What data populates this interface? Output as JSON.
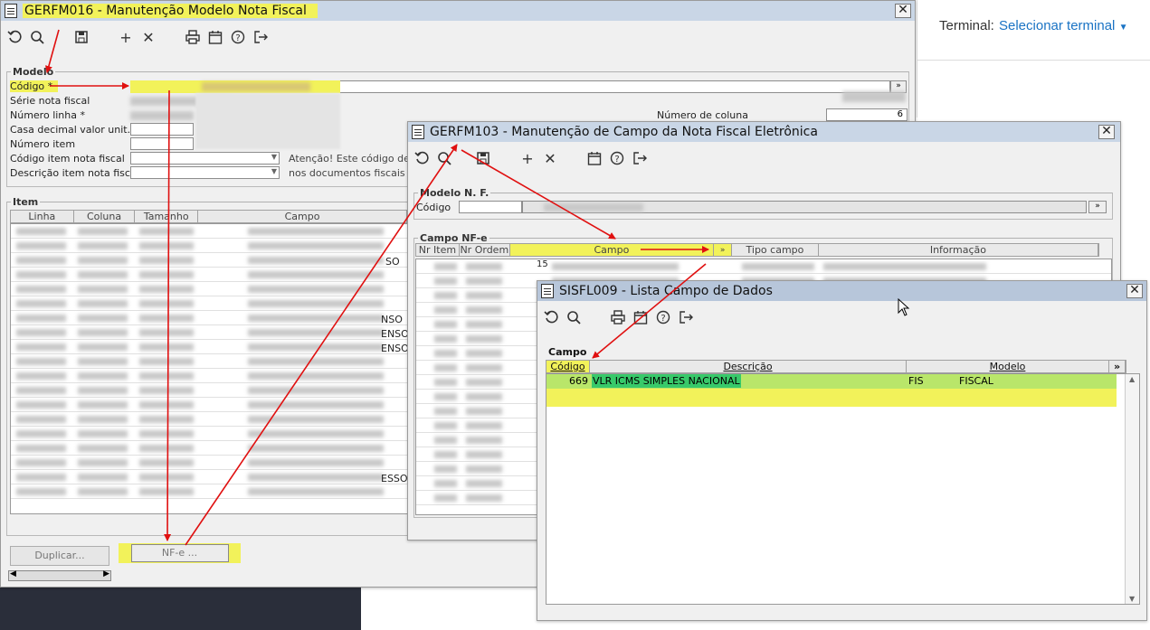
{
  "terminal": {
    "label": "Terminal:",
    "link": "Selecionar terminal"
  },
  "win1": {
    "title": "GERFM016 - Manutenção Modelo Nota Fiscal",
    "close": "✕",
    "group_modelo": "Modelo",
    "labels": {
      "codigo": "Código *",
      "serie": "Série nota fiscal",
      "numero_linha": "Número linha *",
      "casa_decimal": "Casa decimal valor unit.",
      "numero_item": "Número item",
      "codigo_item": "Código item nota fiscal",
      "descricao_item": "Descrição item nota fiscal",
      "numero_coluna": "Número de coluna"
    },
    "numero_coluna_value": "6",
    "atencao": "Atenção! Este código deve",
    "atencao2": "nos documentos fiscais e i",
    "group_item": "Item",
    "item_columns": [
      "Linha",
      "Coluna",
      "Tamanho",
      "Campo"
    ],
    "row_fragments": [
      "SO",
      "NSO",
      "ENSO",
      "ENSO",
      "ESSO"
    ],
    "buttons": {
      "duplicar": "Duplicar...",
      "nfe": "NF-e ..."
    }
  },
  "win2": {
    "title": "GERFM103 - Manutenção de Campo da Nota Fiscal Eletrônica",
    "close": "✕",
    "group_modelo": "Modelo N. F.",
    "codigo_label": "Código",
    "group_campo": "Campo NF-e",
    "columns": [
      "Nr Item",
      "Nr Ordem",
      "Campo",
      "Tipo campo",
      "Informação"
    ],
    "first_row_ordem": "15"
  },
  "win3": {
    "title": "SISFL009 - Lista Campo de Dados",
    "close": "✕",
    "group_campo": "Campo",
    "columns": [
      "Código",
      "Descrição",
      "Modelo"
    ],
    "more": "»",
    "rows": [
      {
        "codigo": "669",
        "descricao": "VLR ICMS SIMPLES NACIONAL",
        "sigla": "FIS",
        "modelo": "FISCAL"
      }
    ]
  },
  "colors": {
    "titlebar": "#c9d6e6",
    "highlight": "#f2f25a",
    "selection": "#38c96a",
    "arrow": "#e01010",
    "link": "#1a73c4"
  }
}
